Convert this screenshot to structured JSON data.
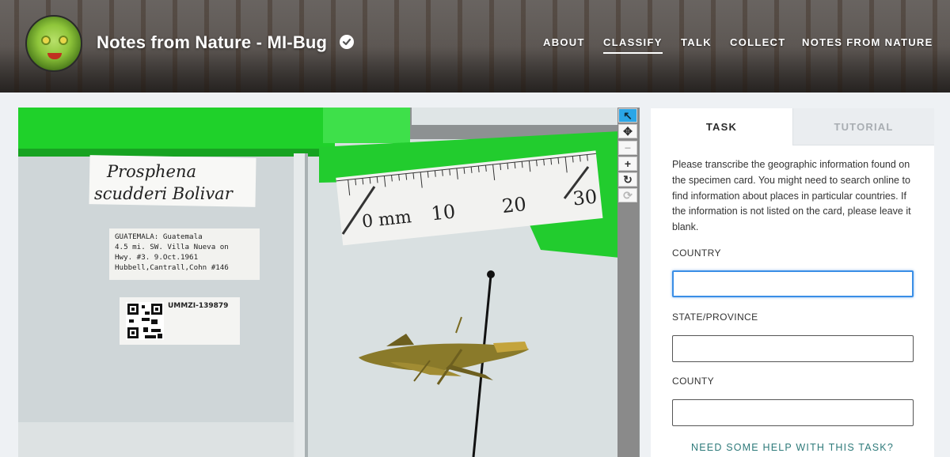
{
  "header": {
    "title": "Notes from Nature - MI-Bug",
    "nav": [
      {
        "label": "ABOUT",
        "active": false
      },
      {
        "label": "CLASSIFY",
        "active": true
      },
      {
        "label": "TALK",
        "active": false
      },
      {
        "label": "COLLECT",
        "active": false
      },
      {
        "label": "NOTES FROM NATURE",
        "active": false
      }
    ]
  },
  "subject": {
    "species_label_line1": "Prosphena",
    "species_label_line2": "scudderi Bolivar",
    "locality_label": [
      "GUATEMALA:        Guatemala",
      "4.5 mi. SW. Villa Nueva on",
      "Hwy. #3.       9.Oct.1961",
      "Hubbell,Cantrall,Cohn #146"
    ],
    "catalog_id": "UMMZI-139879",
    "ruler": {
      "unit_label": "0 mm",
      "ticks": [
        "10",
        "20",
        "30"
      ]
    }
  },
  "toolbar": {
    "icons": [
      "pointer-icon",
      "move-icon",
      "zoom-out-icon",
      "zoom-in-icon",
      "rotate-icon",
      "reset-icon"
    ],
    "glyphs": [
      "↖",
      "✥",
      "−",
      "+",
      "↻",
      "⟳"
    ]
  },
  "panel": {
    "tabs": [
      "TASK",
      "TUTORIAL"
    ],
    "instructions": "Please transcribe the geographic information found on the specimen card. You might need to search online to find information about places in particular countries. If the information is not listed on the card, please leave it blank.",
    "fields": [
      {
        "label": "COUNTRY",
        "value": ""
      },
      {
        "label": "STATE/PROVINCE",
        "value": ""
      },
      {
        "label": "COUNTY",
        "value": ""
      }
    ],
    "help_link": "NEED SOME HELP WITH THIS TASK?"
  },
  "colors": {
    "accent": "#2aa6e8",
    "link": "#2e7a7a",
    "focus": "#3a8ee6"
  }
}
